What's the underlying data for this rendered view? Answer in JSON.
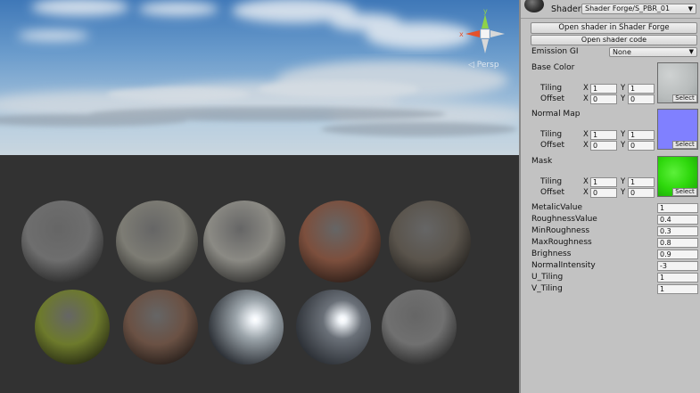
{
  "scene": {
    "gizmo": {
      "y_label": "y",
      "x_label": "x"
    },
    "projection_label": "◁ Persp",
    "spheres_row1": [
      {
        "color": "#6e6e6e"
      },
      {
        "color": "#7d7c74"
      },
      {
        "color": "#8b8a84"
      },
      {
        "color": "#7c4f3d"
      },
      {
        "color": "#5a544c"
      }
    ],
    "spheres_row2": [
      {
        "color": "#6d7a2c"
      },
      {
        "color": "#6a5144"
      },
      {
        "color": "#9ba4aa"
      },
      {
        "color": "#6a7078"
      },
      {
        "color": "#707070"
      }
    ]
  },
  "inspector": {
    "shader_label": "Shader",
    "shader_value": "Shader Forge/S_PBR_01",
    "open_sf_button": "Open shader in Shader Forge",
    "open_code_button": "Open shader code",
    "emission_label": "Emission GI",
    "emission_value": "None",
    "select_label": "Select",
    "textures": [
      {
        "label": "Base Color",
        "color": "#b8bcbc",
        "tiling_label": "Tiling",
        "offset_label": "Offset",
        "tiling_x": "1",
        "tiling_y": "1",
        "offset_x": "0",
        "offset_y": "0"
      },
      {
        "label": "Normal Map",
        "color": "#8080ff",
        "tiling_label": "Tiling",
        "offset_label": "Offset",
        "tiling_x": "1",
        "tiling_y": "1",
        "offset_x": "0",
        "offset_y": "0"
      },
      {
        "label": "Mask",
        "color": "#2ed80c",
        "tiling_label": "Tiling",
        "offset_label": "Offset",
        "tiling_x": "1",
        "tiling_y": "1",
        "offset_x": "0",
        "offset_y": "0"
      }
    ],
    "x_label": "X",
    "y_label": "Y",
    "properties": [
      {
        "label": "MetalicValue",
        "value": "1"
      },
      {
        "label": "RoughnessValue",
        "value": "0.4"
      },
      {
        "label": "MinRoughness",
        "value": "0.3"
      },
      {
        "label": "MaxRoughness",
        "value": "0.8"
      },
      {
        "label": "Brighness",
        "value": "0.9"
      },
      {
        "label": "NormalIntensity",
        "value": "-3"
      },
      {
        "label": "U_Tiling",
        "value": "1"
      },
      {
        "label": "V_Tiling",
        "value": "1"
      }
    ]
  }
}
